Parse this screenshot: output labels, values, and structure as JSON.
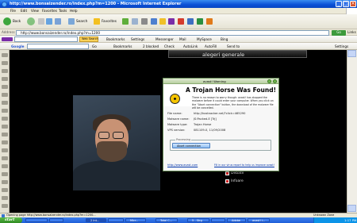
{
  "window": {
    "title": "http://www.bonsaizender.ro/index.php?m=1200 - Microsoft Internet Explorer"
  },
  "menu": [
    "File",
    "Edit",
    "View",
    "Favorites",
    "Tools",
    "Help"
  ],
  "toolbar": {
    "back_label": "Back",
    "search_label": "Search",
    "favorites_label": "Favorites"
  },
  "address": {
    "label": "Address",
    "url": "http://www.bonsaizender.ro/index.php?m=1200",
    "go_label": "Go",
    "links_label": "Links"
  },
  "yahoo_bar": {
    "search_button": "Web Search",
    "items": [
      "Bookmarks",
      "Settings",
      "Messenger",
      "Mail",
      "MySpace",
      "Bing"
    ]
  },
  "google_bar": {
    "label": "Google",
    "go_label": "Go",
    "items": [
      "Bookmarks",
      "2 blocked",
      "Check",
      "AutoLink",
      "AutoFill",
      "Send to"
    ],
    "settings_label": "Settings"
  },
  "page": {
    "header": "alegeri generale",
    "side_menu": [
      "Debate",
      "Infoare"
    ]
  },
  "dialog": {
    "title": "avast! Warning",
    "heading": "A Trojan Horse Was Found!",
    "message": "There is no reason to worry though: avast! has stopped the malware before it could enter your computer. When you click on the \"Abort connection\" button, the download of the malware file will be cancelled.",
    "fields": [
      {
        "label": "File name:",
        "value": "http://hostnacker.net/?click=465290"
      },
      {
        "label": "Malware name:",
        "value": "JS:Packed-E [Trj]"
      },
      {
        "label": "Malware type:",
        "value": "Trojan Horse"
      },
      {
        "label": "VPS version:",
        "value": "081109-0, 11/09/2008"
      }
    ],
    "processing_label": "Processing",
    "abort_button": "Abort connection",
    "link_site": "http://www.avast.com",
    "link_report": "Fill in our virus report to help us improve avast!"
  },
  "status": {
    "text": "Opening page http://www.bonsaizender.ro/index.php?m=1200...",
    "zone": "Unknown Zone"
  },
  "taskbar": {
    "start_label": "start",
    "tasks": [
      "",
      "",
      "2 Int...",
      "",
      "Micr...",
      "Total C...",
      "5 - Strg",
      "",
      "Adobe",
      "avast! i..."
    ],
    "clock": "1:17 PM"
  }
}
